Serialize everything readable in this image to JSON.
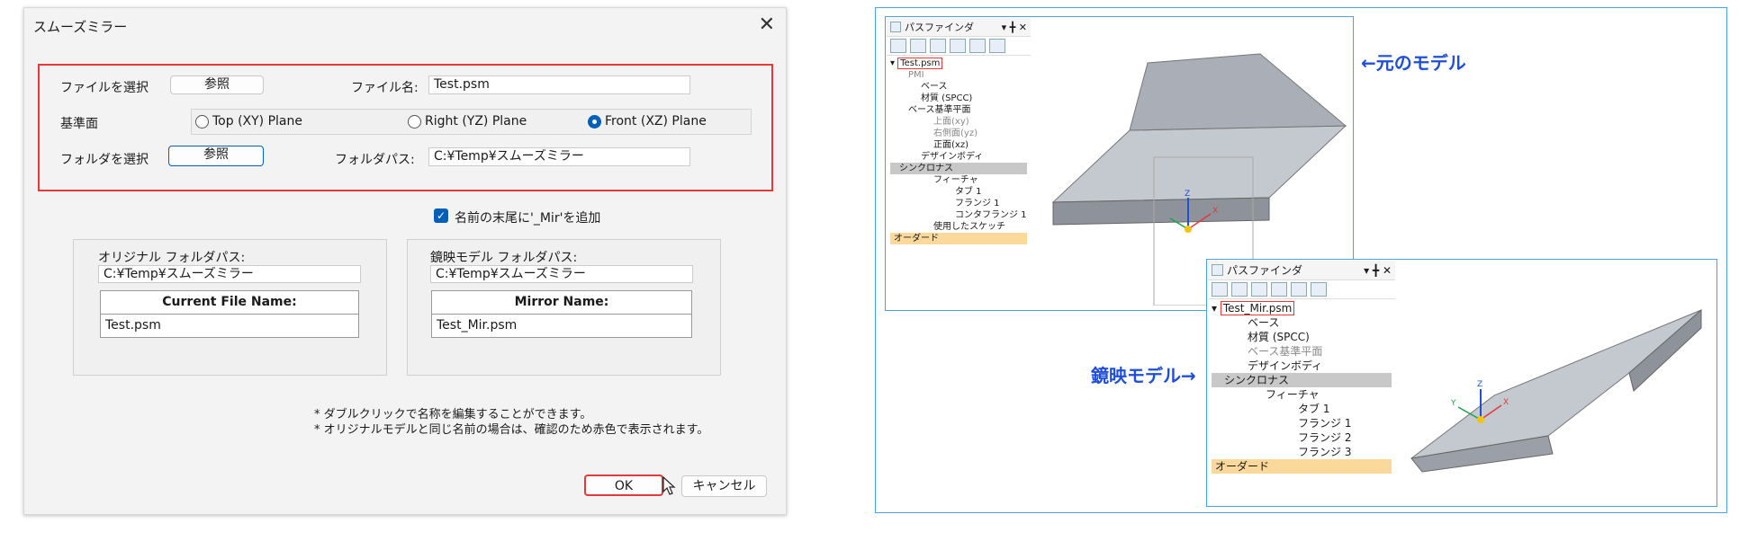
{
  "dialog": {
    "title": "スムーズミラー",
    "close_glyph": "✕",
    "select_file_label": "ファイルを選択",
    "browse_label": "参照",
    "filename_label": "ファイル名:",
    "filename_value": "Test.psm",
    "plane_label": "基準面",
    "planes": [
      "Top (XY) Plane",
      "Right (YZ) Plane",
      "Front (XZ) Plane"
    ],
    "selected_plane": "Front (XZ) Plane",
    "select_folder_label": "フォルダを選択",
    "folder_path_label": "フォルダパス:",
    "folder_path_value": "C:¥Temp¥スムーズミラー",
    "add_suffix_label": "名前の末尾に'_Mir'を追加",
    "add_suffix_checked": true,
    "original_group": {
      "title": "オリジナル フォルダパス:",
      "path": "C:¥Temp¥スムーズミラー",
      "column_header": "Current File Name:",
      "row": "Test.psm"
    },
    "mirror_group": {
      "title": "鏡映モデル フォルダパス:",
      "path": "C:¥Temp¥スムーズミラー",
      "column_header": "Mirror Name:",
      "row": "Test_Mir.psm"
    },
    "notes": [
      "* ダブルクリックで名称を編集することができます。",
      "* オリジナルモデルと同じ名前の場合は、確認のため赤色で表示されます。"
    ],
    "ok_label": "OK",
    "cancel_label": "キャンセル"
  },
  "right": {
    "original_pathfinder": {
      "title": "パスファインダ",
      "root": "Test.psm",
      "items": [
        "PMI",
        "ベース",
        "材質 (SPCC)",
        "ベース基準平面",
        "上面(xy)",
        "右側面(yz)",
        "正面(xz)",
        "デザインボディ",
        "シンクロナス",
        "フィーチャ",
        "タブ 1",
        "フランジ 1",
        "コンタフランジ 1",
        "使用したスケッチ",
        "オーダード"
      ]
    },
    "mirror_pathfinder": {
      "title": "パスファインダ",
      "root": "Test_Mir.psm",
      "items": [
        "ベース",
        "材質 (SPCC)",
        "ベース基準平面",
        "デザインボディ",
        "シンクロナス",
        "フィーチャ",
        "タブ 1",
        "フランジ 1",
        "フランジ 2",
        "フランジ 3",
        "オーダード"
      ]
    },
    "original_note": "←元のモデル",
    "mirror_note": "鏡映モデル→",
    "pf_controls": "▾ ╋ ✕",
    "axis_x": "X",
    "axis_y": "Y",
    "axis_z": "Z"
  },
  "colors": {
    "accent": "#005fb8",
    "highlight": "#e5383b",
    "frame": "#4aa3df",
    "note": "#1f4ed8"
  }
}
